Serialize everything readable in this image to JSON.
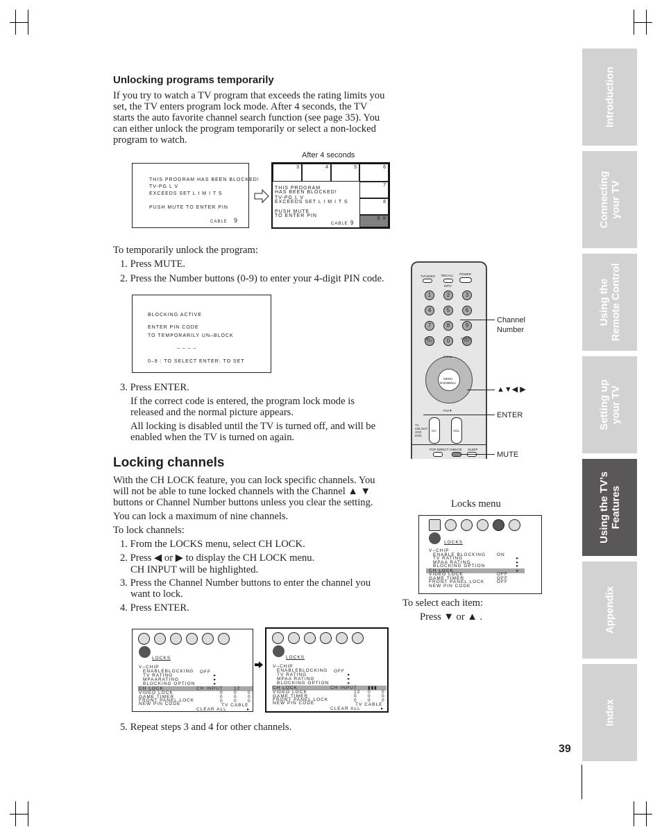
{
  "section1": {
    "heading": "Unlocking programs temporarily",
    "intro": "If you try to watch a TV program that exceeds the rating limits you set, the TV enters program lock mode. After 4 seconds, the TV starts the auto favorite channel search function (see page 35). You can either unlock the program temporarily or select a non-locked program to watch.",
    "after_label": "After 4 seconds",
    "screen1": {
      "l1": "THIS PROGRAM HAS BEEN  BLOCKED!",
      "l2": "TV-PG    L     V",
      "l3": "EXCEEDS SET L I M I T S",
      "l4": "PUSH  MUTE  TO ENTER  PIN",
      "source": "CABLE",
      "channel": "9"
    },
    "screen2": {
      "l1": "THIS  PROGRAM",
      "l2": "HAS  BEEN  BLOCKED!",
      "l3": "TV-PG     L     V",
      "l4": "EXCEEDS  SET  L I M I T S",
      "l5": "PUSH  MUTE",
      "l6": "TO  ENTER  PIN",
      "source": "CABLE",
      "channel": "9",
      "thumbs": [
        "3",
        "4",
        "5",
        "6",
        "7",
        "8"
      ],
      "corner": "9 X"
    },
    "steps_intro": "To temporarily unlock the program:",
    "step1": "1.  Press MUTE.",
    "step2": "2.  Press the Number buttons (0-9) to enter your 4-digit PIN code.",
    "pin_screen": {
      "l1": "BLOCKING  ACTIVE",
      "l2": "ENTER  PIN  CODE",
      "l3": "TO  TEMPORARILY  UN–BLOCK",
      "l4": "_ _ _ _",
      "l5": "0–9 : TO  SELECT     ENTER: TO  SET"
    },
    "step3": "3.  Press ENTER.",
    "step3a": "If the correct code is entered, the program lock mode is released and the normal picture appears.",
    "step3b": "All locking is disabled until the TV is turned off, and will be enabled when the TV is turned on again."
  },
  "remote": {
    "buttons": {
      "tv_video": "TV/VIDEO",
      "recall": "RECALL",
      "info": "INFO",
      "power": "POWER",
      "plus10": "+10",
      "chrtn": "CHRTN",
      "fav_up": "FAV▲",
      "fav_down": "FAV▼",
      "menu": "MENU",
      "dvdmenu": "DVDMENU",
      "ch": "CH",
      "vol": "VOL",
      "mute": "MUTE",
      "sleep": "SLEEP",
      "pop": "POP DIRECT CH",
      "modes": [
        "TV",
        "CBL/SAT",
        "VCR",
        "DVD"
      ],
      "digits": [
        "1",
        "2",
        "3",
        "4",
        "5",
        "6",
        "7",
        "8",
        "9",
        "100",
        "0",
        "ENT"
      ]
    },
    "callouts": {
      "channel_number": "Channel Number",
      "arrows": "▲▼◀ ▶",
      "enter": "ENTER",
      "mute": "MUTE"
    }
  },
  "section2": {
    "heading": "Locking channels",
    "p1": "With the CH LOCK feature, you can lock specific channels. You will not be able to tune locked channels with the Channel ▲ ▼ buttons or Channel Number buttons unless you clear the setting.",
    "p2": "You can lock a maximum of nine channels.",
    "p3": "To lock channels:",
    "s1": "1.  From the LOCKS menu, select CH LOCK.",
    "s2": "2.  Press ◀ or ▶ to display the CH LOCK menu.",
    "s2b": "CH INPUT will be highlighted.",
    "s3": "3.  Press the Channel Number buttons to enter the channel you want to lock.",
    "s4": "4.  Press ENTER.",
    "s5": "5.  Repeat steps 3 and 4 for other channels.",
    "locks_caption": "Locks menu",
    "select_text": "To select each item:",
    "press_text": "Press ▼ or ▲ .",
    "locks_menu": {
      "title": "LOCKS",
      "items": [
        "V–CHIP",
        "ENABLE  BLOCKING",
        "TV  RATING",
        "MPAA  RATING",
        "BLOCKING  OPTION",
        "CH  LOCK",
        "VIDEO  LOCK",
        "GAME  TIMER",
        "FRONT  PANEL  LOCK",
        "NEW  PIN  CODE"
      ],
      "values": [
        "",
        "ON",
        "▸",
        "▸",
        "▸",
        "▸",
        "OFF",
        "OFF",
        "OFF",
        ""
      ]
    },
    "menu_a": {
      "title": "LOCKS",
      "items": [
        "V–CHIP",
        "ENABLEBLOCKING",
        "TV  RATING",
        "MPAARATING",
        "BLOCKING OPTION",
        "CH LOCK",
        "VIDEO LOCK",
        "GAME  TIMER",
        "FRONT  PANEL  LOCK",
        "NEW  PIN  CODE"
      ],
      "enable": "OFF",
      "ch_input": "CH INPUT",
      "ch_value": "12",
      "source": "TV  CABLE",
      "clear": "CLEAR  ALL"
    },
    "menu_b": {
      "title": "LOCKS",
      "items": [
        "V–CHIP",
        "ENABLEBLOCKING",
        "TV  RATING",
        "MPAA  RATING",
        "BLOCKING OPTION",
        "CH LOCK",
        "VIDEO LOCK",
        "GAME  TIMER",
        "FRONT  PANEL  LOCK",
        "NEW  PIN  CODE"
      ],
      "enable": "OFF",
      "ch_input": "CH INPUT",
      "ch_value": "▮▮▮",
      "first": "12",
      "source": "TV  CABLE",
      "clear": "CLEAR  ALL"
    }
  },
  "tabs": [
    {
      "label": "Introduction"
    },
    {
      "label": "Connecting\nyour TV"
    },
    {
      "label": "Using the\nRemote Control"
    },
    {
      "label": "Setting up\nyour TV"
    },
    {
      "label": "Using the TV’s\nFeatures",
      "active": true
    },
    {
      "label": "Appendix"
    },
    {
      "label": "Index"
    }
  ],
  "page_number": "39",
  "colors": {
    "tab": "#d2d2d2",
    "tab_active": "#5a5758",
    "highlight": "#a8a8a8"
  }
}
